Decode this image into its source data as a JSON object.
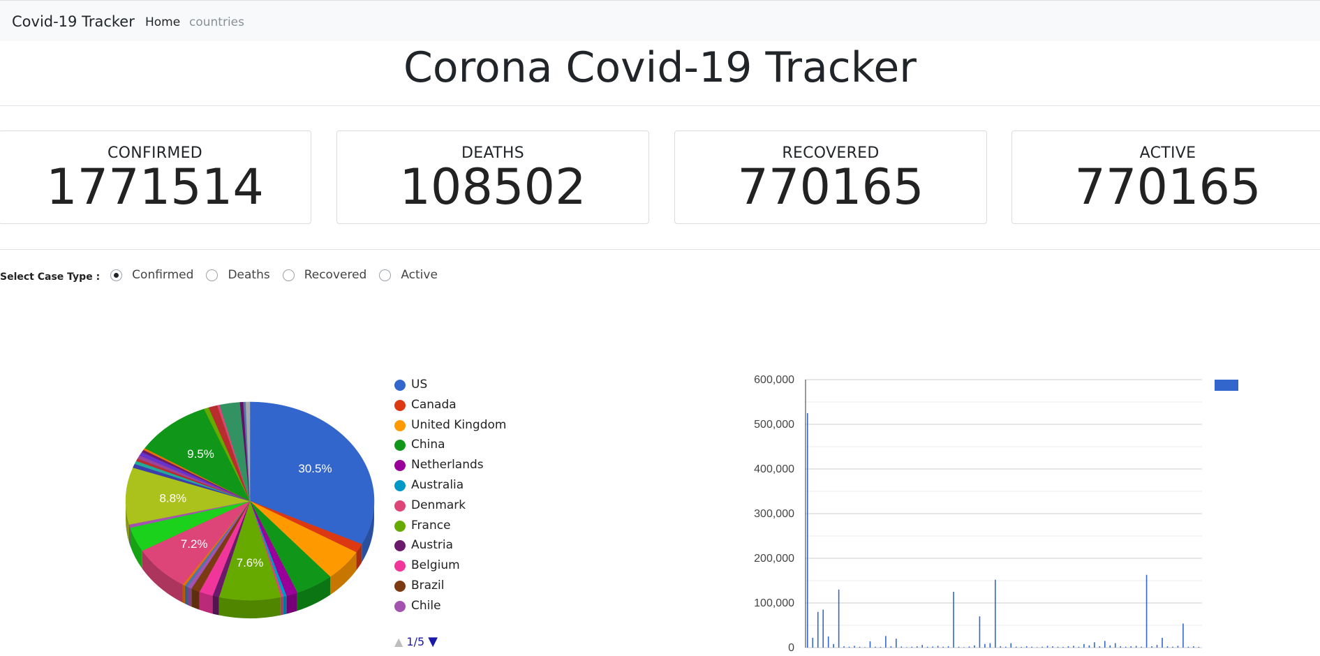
{
  "navbar": {
    "brand": "Covid-19 Tracker",
    "links": [
      "Home",
      "countries"
    ]
  },
  "page_title": "Corona Covid-19 Tracker",
  "stats": [
    {
      "label": "CONFIRMED",
      "value": "1771514"
    },
    {
      "label": "DEATHS",
      "value": "108502"
    },
    {
      "label": "RECOVERED",
      "value": "770165"
    },
    {
      "label": "ACTIVE",
      "value": "770165"
    }
  ],
  "case_type": {
    "label": "Select Case Type :",
    "options": [
      "Confirmed",
      "Deaths",
      "Recovered",
      "Active"
    ],
    "selected": "Confirmed"
  },
  "pie_legend": {
    "items": [
      {
        "name": "US",
        "color": "#3366cc"
      },
      {
        "name": "Canada",
        "color": "#dc3912"
      },
      {
        "name": "United Kingdom",
        "color": "#ff9900"
      },
      {
        "name": "China",
        "color": "#109618"
      },
      {
        "name": "Netherlands",
        "color": "#990099"
      },
      {
        "name": "Australia",
        "color": "#0099c6"
      },
      {
        "name": "Denmark",
        "color": "#dd4477"
      },
      {
        "name": "France",
        "color": "#66aa00"
      },
      {
        "name": "Austria",
        "color": "#6b1a6b"
      },
      {
        "name": "Belgium",
        "color": "#f0369a"
      },
      {
        "name": "Brazil",
        "color": "#7a3b12"
      },
      {
        "name": "Chile",
        "color": "#a352b0"
      }
    ],
    "page": "1/5"
  },
  "chart_data": [
    {
      "type": "pie",
      "three_d": true,
      "slices": [
        {
          "label": "US",
          "value": 30.5,
          "color": "#3366cc",
          "label_shown": "30.5%"
        },
        {
          "label": "Canada",
          "value": 1.4,
          "color": "#dc3912"
        },
        {
          "label": "United Kingdom",
          "value": 4.9,
          "color": "#ff9900"
        },
        {
          "label": "China",
          "value": 4.7,
          "color": "#109618"
        },
        {
          "label": "Netherlands",
          "value": 1.4,
          "color": "#990099"
        },
        {
          "label": "Australia",
          "value": 0.4,
          "color": "#0099c6"
        },
        {
          "label": "Denmark",
          "value": 0.3,
          "color": "#dd4477"
        },
        {
          "label": "France",
          "value": 7.6,
          "color": "#66aa00",
          "label_shown": "7.6%"
        },
        {
          "label": "Austria",
          "value": 0.8,
          "color": "#6b1a6b"
        },
        {
          "label": "Belgium",
          "value": 1.7,
          "color": "#f0369a"
        },
        {
          "label": "Brazil",
          "value": 1.1,
          "color": "#7a3b12"
        },
        {
          "label": "Chile",
          "value": 0.5,
          "color": "#a352b0"
        },
        {
          "label": "",
          "value": 0.4,
          "color": "#5574a6"
        },
        {
          "label": "",
          "value": 0.3,
          "color": "#e67300"
        },
        {
          "label": "",
          "value": 7.2,
          "color": "#dd4477",
          "label_shown": "7.2%"
        },
        {
          "label": "",
          "value": 3.8,
          "color": "#1bd11b"
        },
        {
          "label": "",
          "value": 0.5,
          "color": "#a352b0"
        },
        {
          "label": "",
          "value": 8.8,
          "color": "#aac21b",
          "label_shown": "8.8%"
        },
        {
          "label": "",
          "value": 0.6,
          "color": "#3b3eac"
        },
        {
          "label": "",
          "value": 0.5,
          "color": "#22aa99"
        },
        {
          "label": "",
          "value": 0.4,
          "color": "#b82e2e"
        },
        {
          "label": "",
          "value": 0.5,
          "color": "#994499"
        },
        {
          "label": "",
          "value": 0.6,
          "color": "#6633cc"
        },
        {
          "label": "",
          "value": 0.4,
          "color": "#6b1a6b"
        },
        {
          "label": "",
          "value": 0.3,
          "color": "#e67300"
        },
        {
          "label": "",
          "value": 9.5,
          "color": "#109618",
          "label_shown": "9.5%"
        },
        {
          "label": "",
          "value": 0.6,
          "color": "#66aa00"
        },
        {
          "label": "",
          "value": 1.1,
          "color": "#b82e2e"
        },
        {
          "label": "",
          "value": 0.3,
          "color": "#dd4477"
        },
        {
          "label": "",
          "value": 2.5,
          "color": "#329262"
        },
        {
          "label": "",
          "value": 0.4,
          "color": "#651067"
        },
        {
          "label": "",
          "value": 0.3,
          "color": "#5574a6"
        },
        {
          "label": "",
          "value": 0.5,
          "color": "#aaaaaa"
        }
      ]
    },
    {
      "type": "bar",
      "ylim": [
        0,
        600000
      ],
      "y_ticks": [
        "0",
        "100,000",
        "200,000",
        "300,000",
        "400,000",
        "500,000",
        "600,000"
      ],
      "color": "#3366cc",
      "series": [
        {
          "values": [
            525000,
            22000,
            80000,
            85000,
            25000,
            8000,
            130000,
            3000,
            2000,
            4000,
            2000,
            1000,
            14000,
            2000,
            1500,
            26000,
            3000,
            20000,
            2500,
            1000,
            2000,
            3000,
            6000,
            2000,
            2500,
            4000,
            2000,
            3000,
            125000,
            2000,
            1000,
            2500,
            5000,
            70000,
            8000,
            10000,
            152000,
            3000,
            2000,
            10000,
            2000,
            1500,
            3000,
            2000,
            1000,
            2000,
            4000,
            3000,
            2000,
            1500,
            3000,
            4000,
            2000,
            8000,
            5000,
            12000,
            3000,
            15000,
            5000,
            10000,
            3000,
            2000,
            3000,
            4000,
            2000,
            163000,
            3000,
            6000,
            22000,
            3000,
            2000,
            4000,
            54000,
            2000,
            3000,
            1500
          ]
        }
      ]
    }
  ]
}
